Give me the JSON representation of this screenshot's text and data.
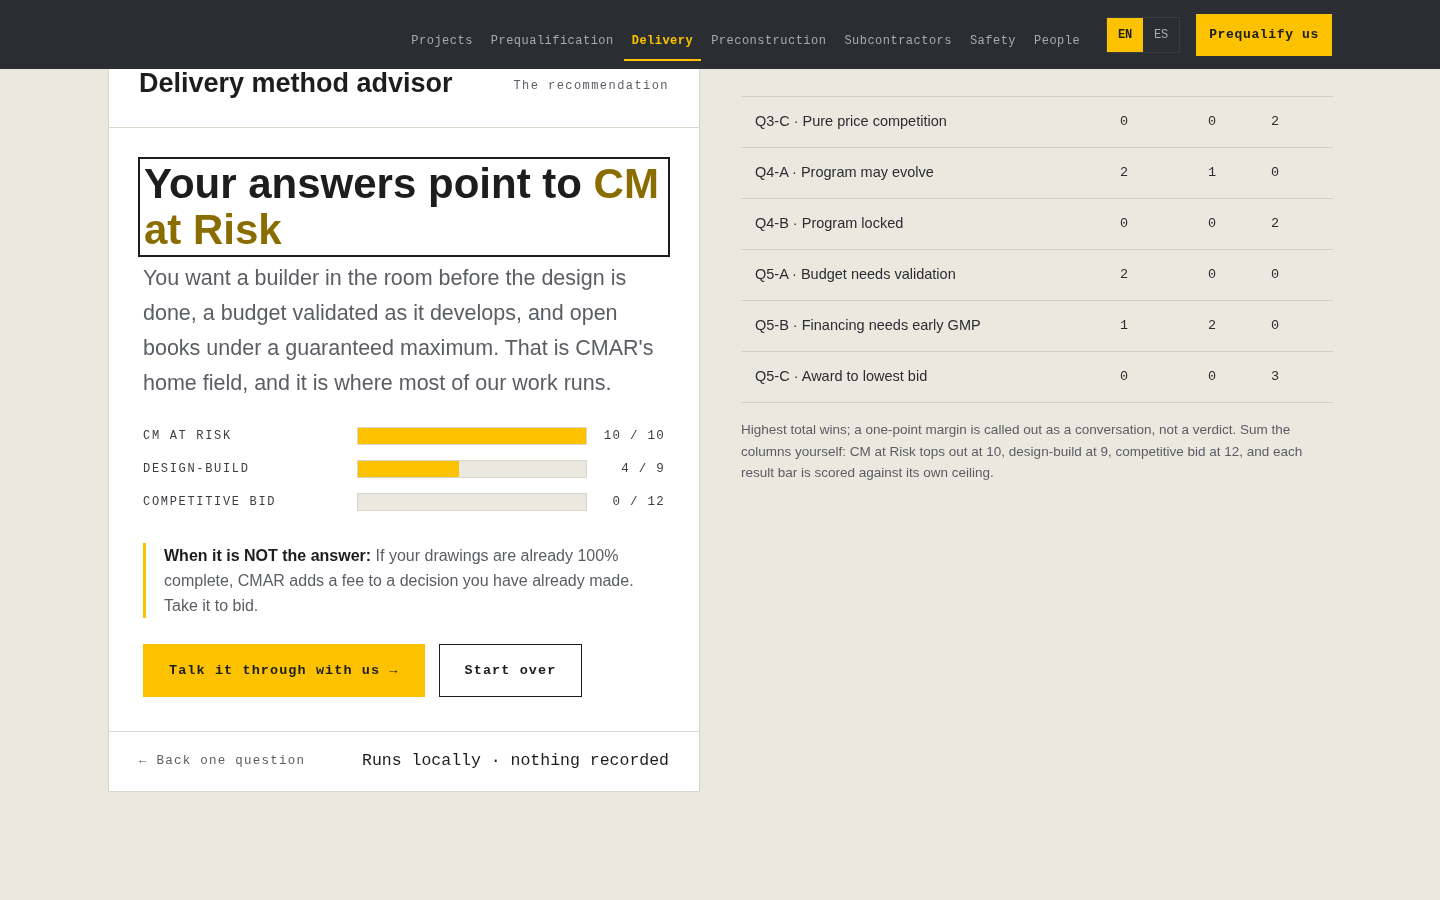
{
  "nav": {
    "items": [
      {
        "label": "Projects",
        "selected": false
      },
      {
        "label": "Prequalification",
        "selected": false
      },
      {
        "label": "Delivery",
        "selected": true
      },
      {
        "label": "Preconstruction",
        "selected": false
      },
      {
        "label": "Subcontractors",
        "selected": false
      },
      {
        "label": "Safety",
        "selected": false
      },
      {
        "label": "People",
        "selected": false
      }
    ],
    "languages": [
      {
        "label": "EN",
        "selected": true
      },
      {
        "label": "ES",
        "selected": false
      }
    ],
    "cta": "Prequalify us"
  },
  "advisor": {
    "title": "Delivery method advisor",
    "step": "The recommendation",
    "headline_lead": "Your answers point to",
    "headline_highlight": "CM at Risk",
    "summary": "You want a builder in the room before the design is done, a budget validated as it develops, and open books under a guaranteed maximum. That is CMAR's home field, and it is where most of our work runs.",
    "scores": [
      {
        "label": "CM AT RISK",
        "level": 1.0,
        "reading": "10 / 10"
      },
      {
        "label": "DESIGN-BUILD",
        "level": 0.444,
        "reading": "4 / 9"
      },
      {
        "label": "COMPETITIVE BID",
        "level": 0.0,
        "reading": "0 / 12"
      }
    ],
    "caveat": "**When it is NOT the answer:** If your drawings are already 100% complete, CMAR adds a fee to a decision you have already made. Take it to bid.",
    "buttons": [
      {
        "label": "Talk it through with us →",
        "kind": "primary"
      },
      {
        "label": "Start over",
        "kind": "outline"
      }
    ],
    "back": "← Back one question",
    "privacy": "Runs locally · nothing recorded"
  },
  "scoring_table": {
    "rows": [
      {
        "answer": "Q3-C · Pure price competition",
        "values": [
          "0",
          "0",
          "2"
        ]
      },
      {
        "answer": "Q4-A · Program may evolve",
        "values": [
          "2",
          "1",
          "0"
        ]
      },
      {
        "answer": "Q4-B · Program locked",
        "values": [
          "0",
          "0",
          "2"
        ]
      },
      {
        "answer": "Q5-A · Budget needs validation",
        "values": [
          "2",
          "0",
          "0"
        ]
      },
      {
        "answer": "Q5-B · Financing needs early GMP",
        "values": [
          "1",
          "2",
          "0"
        ]
      },
      {
        "answer": "Q5-C · Award to lowest bid",
        "values": [
          "0",
          "0",
          "3"
        ]
      }
    ],
    "note": "Highest total wins; a one-point margin is called out as a conversation, not a verdict. Sum the columns yourself: CM at Risk tops out at 10, design-build at 9, competitive bid at 12, and each result bar is scored against its own ceiling."
  }
}
